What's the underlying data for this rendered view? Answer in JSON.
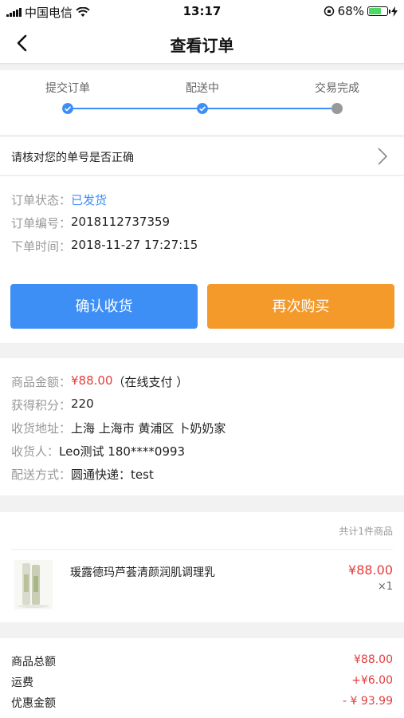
{
  "status_bar": {
    "carrier": "中国电信",
    "time": "13:17",
    "battery": "68%",
    "battery_level": 0.68
  },
  "nav": {
    "title": "查看订单",
    "back_icon": "chevron-left-icon"
  },
  "progress": {
    "steps": [
      {
        "label": "提交订单",
        "state": "done"
      },
      {
        "label": "配送中",
        "state": "done"
      },
      {
        "label": "交易完成",
        "state": "pending"
      }
    ],
    "active_color": "#3d8ef5",
    "inactive_color": "#999999"
  },
  "verify_prompt": "请核对您的单号是否正确",
  "order": {
    "status_label": "订单状态：",
    "status_value": "已发货",
    "number_label": "订单编号：",
    "number_value": "2018112737359",
    "time_label": "下单时间：",
    "time_value": "2018-11-27 17:27:15"
  },
  "buttons": {
    "confirm": "确认收货",
    "rebuy": "再次购买"
  },
  "shipping": {
    "amount_label": "商品金额：",
    "amount_value": "¥88.00",
    "amount_note": "（在线支付 ）",
    "points_label": "获得积分：",
    "points_value": "220",
    "address_label": "收货地址：",
    "address_value": "上海 上海市 黄浦区 卜奶奶家",
    "receiver_label": "收货人：",
    "receiver_value": "Leo测试  180****0993",
    "method_label": "配送方式：",
    "method_value": "圆通快递：test"
  },
  "goods": {
    "count_text": "共计1件商品",
    "items": [
      {
        "name": "瑗露德玛芦荟清颜润肌调理乳",
        "price": "¥88.00",
        "qty": "×1"
      }
    ]
  },
  "totals": [
    {
      "label": "商品总额",
      "value": "¥88.00"
    },
    {
      "label": "运费",
      "value": "+¥6.00"
    },
    {
      "label": "优惠金额",
      "value": "- ¥ 93.99"
    }
  ]
}
